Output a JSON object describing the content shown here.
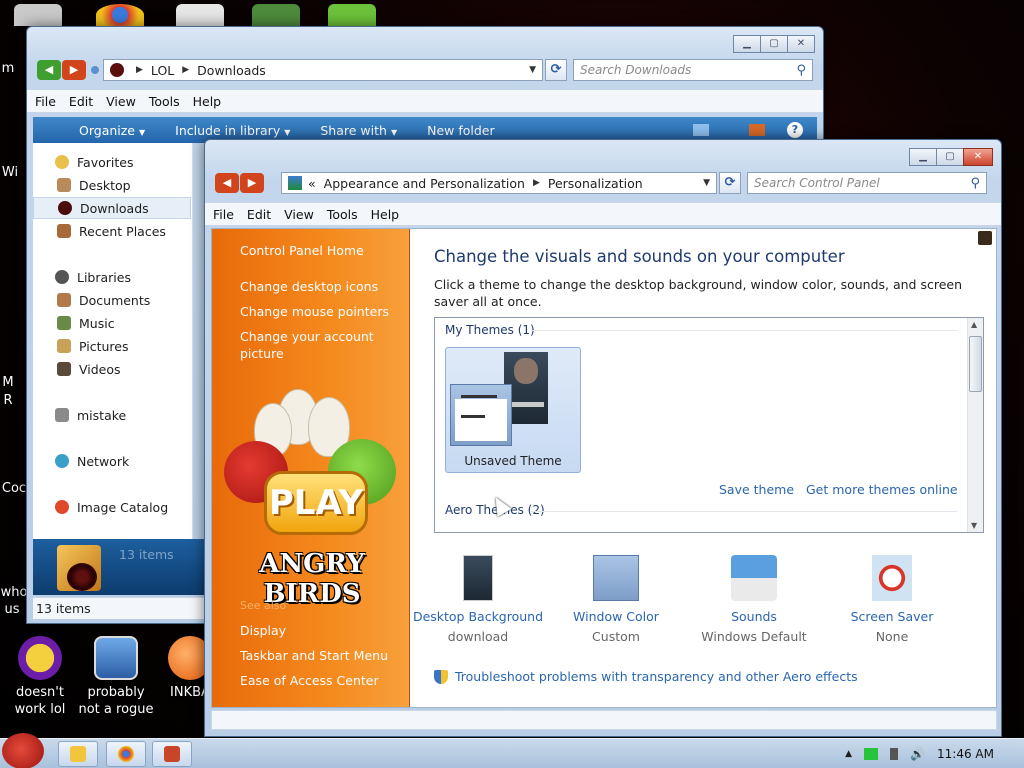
{
  "desktop": {
    "icons": [
      {
        "label_line1": "doesn't",
        "label_line2": "work lol"
      },
      {
        "label_line1": "probably",
        "label_line2": "not a rogue"
      },
      {
        "label_line1": "INKBA",
        "label_line2": ""
      }
    ],
    "edge_labels": [
      "m",
      "Wi",
      "M",
      "R",
      "Coc",
      "who",
      "us"
    ]
  },
  "explorer": {
    "address": {
      "crumbs": [
        "LOL",
        "Downloads"
      ]
    },
    "search_placeholder": "Search Downloads",
    "menu": [
      "File",
      "Edit",
      "View",
      "Tools",
      "Help"
    ],
    "commands": {
      "organize": "Organize",
      "include": "Include in library",
      "share": "Share with",
      "new_folder": "New folder"
    },
    "nav": {
      "favorites": "Favorites",
      "desktop": "Desktop",
      "downloads": "Downloads",
      "recent": "Recent Places",
      "libraries": "Libraries",
      "documents": "Documents",
      "music": "Music",
      "pictures": "Pictures",
      "videos": "Videos",
      "mistake": "mistake",
      "network": "Network",
      "image_catalog": "Image Catalog"
    },
    "details_count": "13 items",
    "status": "13 items"
  },
  "control_panel": {
    "address": {
      "crumbs": [
        "Appearance and Personalization",
        "Personalization"
      ]
    },
    "search_placeholder": "Search Control Panel",
    "menu": [
      "File",
      "Edit",
      "View",
      "Tools",
      "Help"
    ],
    "left_links": {
      "home": "Control Panel Home",
      "desktop_icons": "Change desktop icons",
      "mouse_pointers": "Change mouse pointers",
      "account_picture": "Change your account picture",
      "see_also": "See also",
      "display": "Display",
      "taskbar": "Taskbar and Start Menu",
      "ease": "Ease of Access Center"
    },
    "art": {
      "play": "PLAY",
      "title": "ANGRY BIRDS"
    },
    "title": "Change the visuals and sounds on your computer",
    "description": "Click a theme to change the desktop background, window color, sounds, and screen saver all at once.",
    "themes": {
      "my_themes": "My Themes (1)",
      "unsaved": "Unsaved Theme",
      "save_theme": "Save theme",
      "get_more": "Get more themes online",
      "aero_themes": "Aero Themes (2)"
    },
    "options": [
      {
        "label": "Desktop Background",
        "value": "download"
      },
      {
        "label": "Window Color",
        "value": "Custom"
      },
      {
        "label": "Sounds",
        "value": "Windows Default"
      },
      {
        "label": "Screen Saver",
        "value": "None"
      }
    ],
    "troubleshoot": "Troubleshoot problems with transparency and other Aero effects"
  },
  "taskbar": {
    "clock": "11:46 AM"
  },
  "colors": {
    "accent_orange": "#f58a1e",
    "link_blue": "#2a66b0",
    "command_bar": "#2566ab"
  }
}
